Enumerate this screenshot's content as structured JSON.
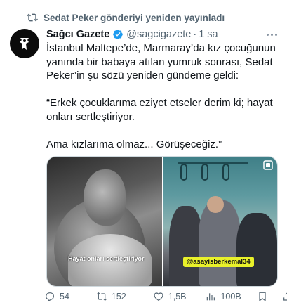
{
  "repost": {
    "icon": "repost-icon",
    "text": "Sedat Peker gönderiyi yeniden yayınladı"
  },
  "author": {
    "name": "Sağcı Gazete",
    "handle": "@sagcigazete",
    "separator": "·",
    "time": "1 sa",
    "verified_color": "#1d9bf0"
  },
  "tweet": {
    "paragraphs": [
      "İstanbul Maltepe’de, Marmaray’da kız çocuğunun yanında bir babaya atılan yumruk sonrası, Sedat Peker’in şu sözü yeniden gündeme geldi:",
      "“Erkek çocuklarıma eziyet etseler derim ki; hayat onları sertleştiriyor.",
      "Ama kızlarıma olmaz... Görüşeceğiz.”"
    ]
  },
  "media": {
    "left_caption": "Hayat onları sertleştiriyor",
    "right_tag": "@asayisberkemal34"
  },
  "actions": {
    "replies": "54",
    "retweets": "152",
    "likes": "1,5B",
    "views": "100B"
  },
  "colors": {
    "text": "#0f1419",
    "secondary": "#536471",
    "accent": "#1d9bf0"
  }
}
